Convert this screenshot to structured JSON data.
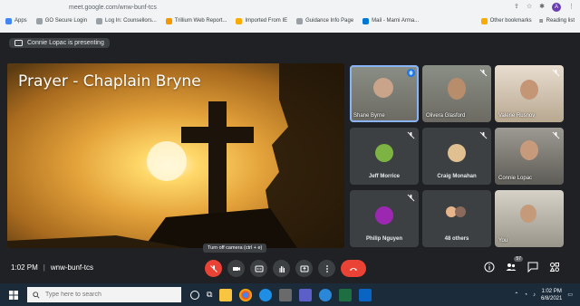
{
  "browser": {
    "url": "meet.google.com/wnw-bunf-tcs",
    "avatar_letter": "A",
    "bookmarks": [
      "Apps",
      "GO Secure Login",
      "Log In: Counsellors...",
      "Trillium Web Report...",
      "Imported From IE",
      "Guidance Info Page",
      "Mail - Marni Arma..."
    ],
    "other_bookmarks": "Other bookmarks",
    "reading_list": "Reading list"
  },
  "meet": {
    "presenting_text": "Connie Lopac is presenting",
    "slide_title": "Prayer - Chaplain Bryne",
    "tiles": [
      {
        "name": "Shane Byrne",
        "kind": "camera"
      },
      {
        "name": "Olivera Glasford",
        "kind": "camera"
      },
      {
        "name": "Valerie Rusnov",
        "kind": "camera"
      },
      {
        "name": "Jeff Morrice",
        "kind": "avatar"
      },
      {
        "name": "Craig Monahan",
        "kind": "avatar"
      },
      {
        "name": "Connie Lopac",
        "kind": "camera"
      },
      {
        "name": "Philip Nguyen",
        "kind": "avatar"
      },
      {
        "name": "48 others",
        "kind": "group"
      },
      {
        "name": "You",
        "kind": "camera"
      }
    ],
    "time": "1:02 PM",
    "meeting_code": "wnw-bunf-tcs",
    "tooltip": "Turn off camera (ctrl + e)",
    "participants_count": "57"
  },
  "taskbar": {
    "search_placeholder": "Type here to search",
    "clock_time": "1:02 PM",
    "clock_date": "6/8/2021"
  },
  "colors": {
    "meet_bg": "#202124",
    "tile_bg": "#3c4043",
    "end_call": "#ea4335",
    "active_speaker": "#8ab4f8"
  }
}
